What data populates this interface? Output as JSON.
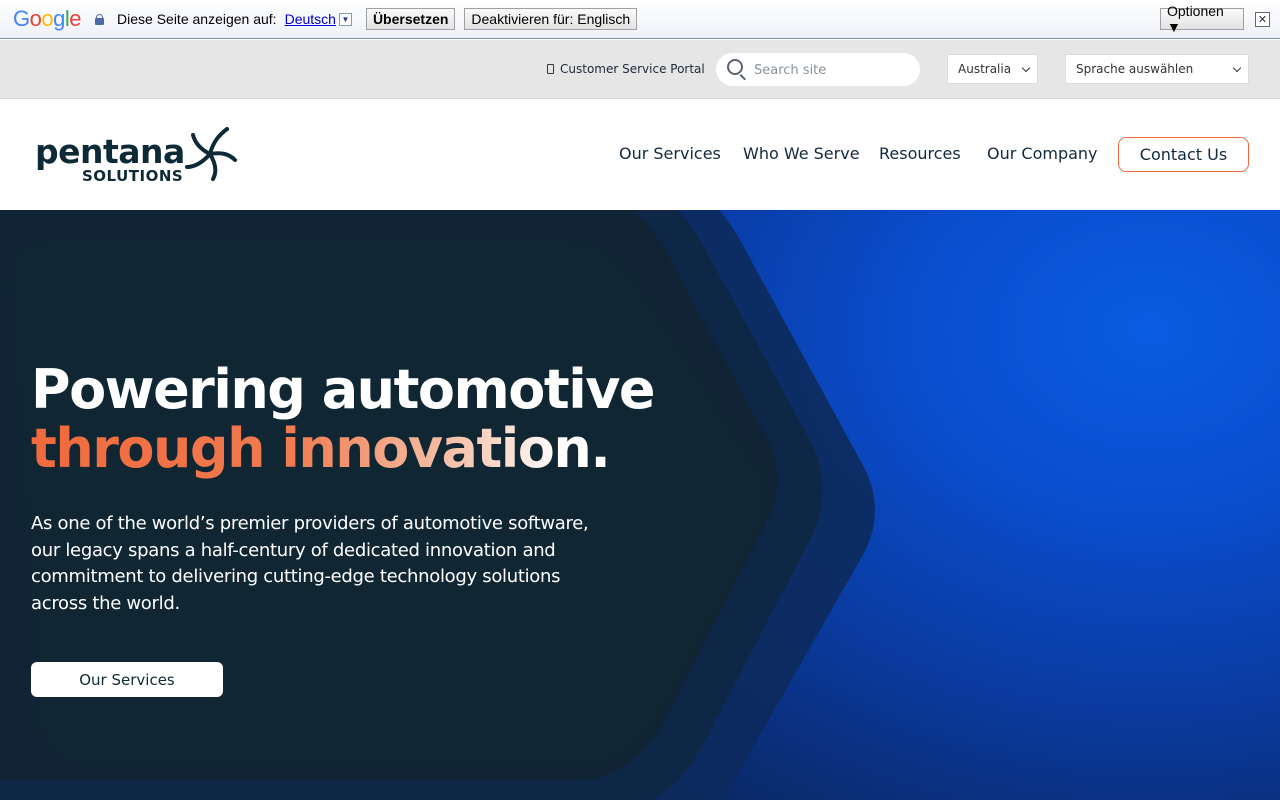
{
  "translate_bar": {
    "logo": "Google",
    "prompt": "Diese Seite anzeigen auf:",
    "language": "Deutsch",
    "translate_button": "Übersetzen",
    "disable_button": "Deaktivieren für: Englisch",
    "options_button": "Optionen ▼",
    "close_glyph": "✕"
  },
  "utility": {
    "customer_portal": "Customer Service Portal",
    "search_placeholder": "Search site",
    "country": "Australia",
    "language_select": "Sprache auswählen"
  },
  "header": {
    "logo_word": "pentana",
    "logo_sub": "SOLUTIONS",
    "nav": [
      "Our Services",
      "Who We Serve",
      "Resources",
      "Our Company"
    ],
    "contact": "Contact Us"
  },
  "hero": {
    "headline_line1": "Powering automotive",
    "headline_line2": "through innovation.",
    "lead": "As one of the world’s premier providers of automotive software, our legacy spans a half-century of dedicated innovation and commitment to delivering cutting-edge technology solutions across the world.",
    "cta": "Our Services"
  },
  "colors": {
    "brand_dark": "#0e2a36",
    "accent_orange": "#f06a3d",
    "hero_blue": "#0a5ce0"
  }
}
